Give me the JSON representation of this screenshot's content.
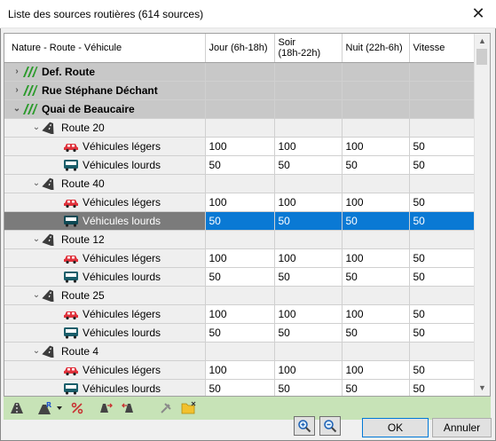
{
  "window": {
    "title": "Liste des sources routières (614 sources)",
    "close_glyph": "✕"
  },
  "columns": [
    "Nature - Route - Véhicule",
    "Jour (6h-18h)",
    "Soir\n(18h-22h)",
    "Nuit (22h-6h)",
    "Vitesse"
  ],
  "rows": [
    {
      "kind": "group",
      "label": "Def. Route",
      "expanded": false
    },
    {
      "kind": "group",
      "label": "Rue Stéphane Déchant",
      "expanded": false
    },
    {
      "kind": "group",
      "label": "Quai de Beaucaire",
      "expanded": true
    },
    {
      "kind": "route",
      "label": "Route 20"
    },
    {
      "kind": "veh",
      "vehicle": "car",
      "label": "Véhicules légers",
      "jour": "100",
      "soir": "100",
      "nuit": "100",
      "vitesse": "50"
    },
    {
      "kind": "veh",
      "vehicle": "truck",
      "label": "Véhicules lourds",
      "jour": "50",
      "soir": "50",
      "nuit": "50",
      "vitesse": "50"
    },
    {
      "kind": "route",
      "label": "Route 40"
    },
    {
      "kind": "veh",
      "vehicle": "car",
      "label": "Véhicules légers",
      "jour": "100",
      "soir": "100",
      "nuit": "100",
      "vitesse": "50"
    },
    {
      "kind": "veh",
      "vehicle": "truck",
      "label": "Véhicules lourds",
      "jour": "50",
      "soir": "50",
      "nuit": "50",
      "vitesse": "50",
      "selected": true
    },
    {
      "kind": "route",
      "label": "Route 12"
    },
    {
      "kind": "veh",
      "vehicle": "car",
      "label": "Véhicules légers",
      "jour": "100",
      "soir": "100",
      "nuit": "100",
      "vitesse": "50"
    },
    {
      "kind": "veh",
      "vehicle": "truck",
      "label": "Véhicules lourds",
      "jour": "50",
      "soir": "50",
      "nuit": "50",
      "vitesse": "50"
    },
    {
      "kind": "route",
      "label": "Route 25"
    },
    {
      "kind": "veh",
      "vehicle": "car",
      "label": "Véhicules légers",
      "jour": "100",
      "soir": "100",
      "nuit": "100",
      "vitesse": "50"
    },
    {
      "kind": "veh",
      "vehicle": "truck",
      "label": "Véhicules lourds",
      "jour": "50",
      "soir": "50",
      "nuit": "50",
      "vitesse": "50"
    },
    {
      "kind": "route",
      "label": "Route 4"
    },
    {
      "kind": "veh",
      "vehicle": "car",
      "label": "Véhicules légers",
      "jour": "100",
      "soir": "100",
      "nuit": "100",
      "vitesse": "50"
    },
    {
      "kind": "veh",
      "vehicle": "truck",
      "label": "Véhicules lourds",
      "jour": "50",
      "soir": "50",
      "nuit": "50",
      "vitesse": "50"
    }
  ],
  "toolbar": {
    "buttons": [
      "road-icon",
      "road-add-icon",
      "dropdown-arrow-icon",
      "percent-icon",
      "split-icon",
      "merge-icon",
      "pin-icon",
      "folder-star-icon"
    ],
    "bg_color": "#c7e3b7"
  },
  "buttons": {
    "ok": "OK",
    "cancel": "Annuler",
    "zoom_in": "zoom-in-icon",
    "zoom_out": "zoom-out-icon"
  },
  "colors": {
    "selection": "#0a79d4",
    "group_bg": "#c8c8c8",
    "car": "#e0323c",
    "truck": "#1a5e6a",
    "road": "#2a9a2a"
  }
}
